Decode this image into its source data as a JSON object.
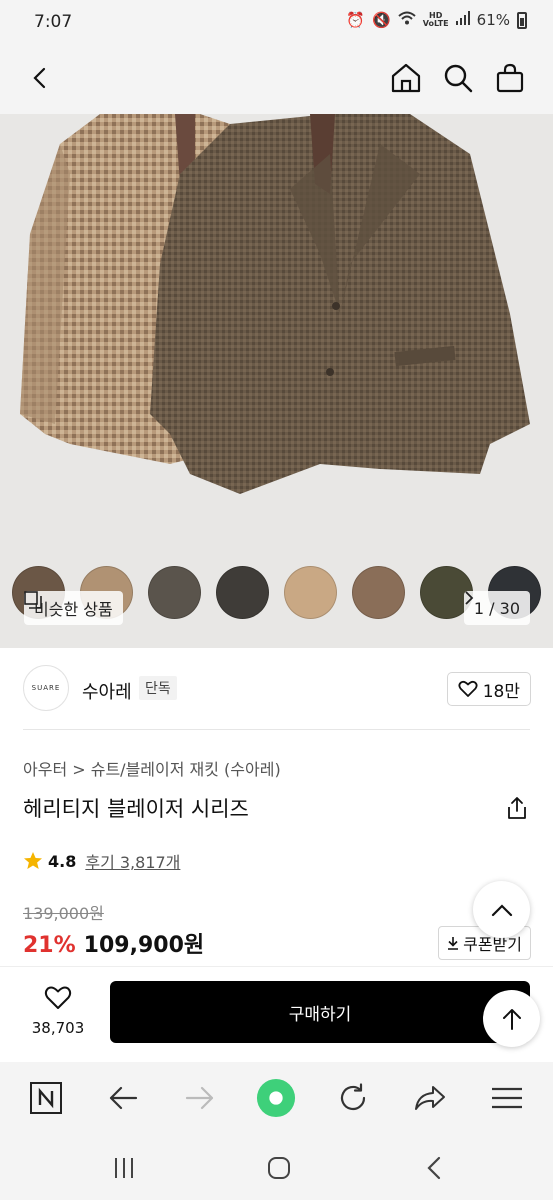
{
  "status_bar": {
    "time": "7:07",
    "battery": "61%"
  },
  "product": {
    "swatches": [
      "#6b5746",
      "#b09273",
      "#5a544c",
      "#3f3c38",
      "#c9a884",
      "#8a6e58",
      "#4a4a36",
      "#2f3236"
    ],
    "similar_label": "비슷한 상품",
    "page_indicator": "1 / 30",
    "brand_logo_text": "SUARE",
    "brand_name": "수아레",
    "brand_badge": "단독",
    "like_count": "18만",
    "breadcrumb": "아우터 > 슈트/블레이저 재킷 (수아레)",
    "title": "헤리티지 블레이저 시리즈",
    "rating": "4.8",
    "reviews": "후기 3,817개",
    "original_price": "139,000원",
    "discount": "21%",
    "sale_price": "109,900원",
    "coupon_label": "쿠폰받기"
  },
  "purchase": {
    "wish_count": "38,703",
    "buy_label": "구매하기"
  },
  "colors": {
    "accent_red": "#e0322f",
    "buy_button": "#000000",
    "chrome_bg": "#f4f4f4",
    "star": "#f5b400",
    "browser_home": "#3ed07a"
  }
}
